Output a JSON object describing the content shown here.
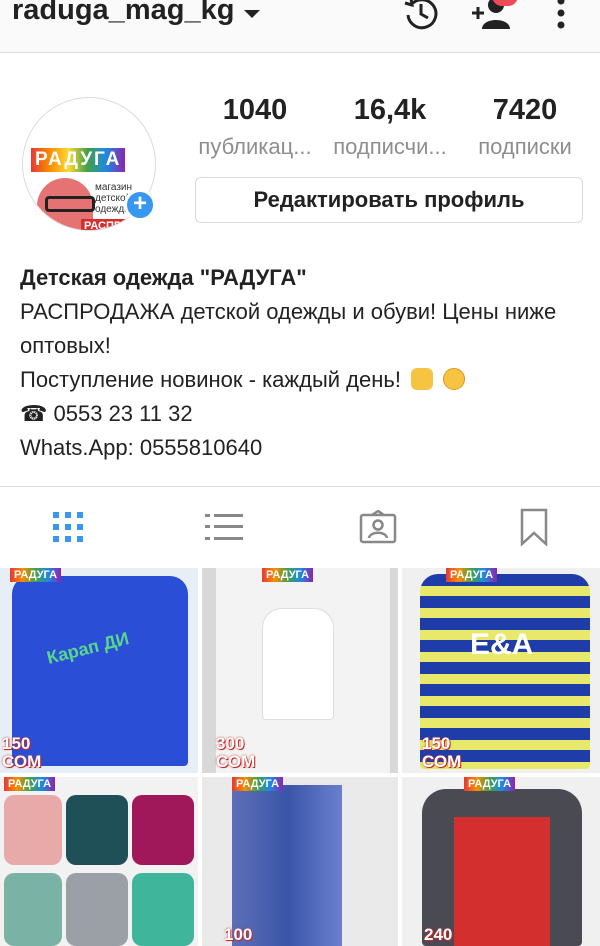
{
  "header": {
    "username": "raduga_mag_kg",
    "icons": [
      "chevron-down-icon",
      "history-icon",
      "add-user-icon",
      "more-icon"
    ]
  },
  "profile": {
    "avatar_brand": "РАДУГА",
    "avatar_subtitle": "магазин детской одежды",
    "avatar_sale": "РАСПРОДАЖА",
    "stats": [
      {
        "value": "1040",
        "label": "публикац..."
      },
      {
        "value": "16,4k",
        "label": "подписчи..."
      },
      {
        "value": "7420",
        "label": "подписки"
      }
    ],
    "edit_button": "Редактировать профиль"
  },
  "bio": {
    "name": "Детская одежда \"РАДУГА\"",
    "line1": "РАСПРОДАЖА детской одежды и обуви! Цены ниже оптовых!",
    "line2": "Поступление новинок - каждый день!",
    "phone": "☎ 0553 23 11 32",
    "whatsapp": "Whats.App: 0555810640"
  },
  "tabs": [
    "grid-icon",
    "list-icon",
    "tagged-icon",
    "saved-icon"
  ],
  "posts": [
    {
      "price": "150 СОМ",
      "tag": "РАДУГА",
      "color": "#2a4fd6"
    },
    {
      "price": "300 СОМ",
      "tag": "РАДУГА",
      "color": "#f0f0f0"
    },
    {
      "price": "150 СОМ",
      "tag": "РАДУГА",
      "color": "#1f3da8"
    },
    {
      "price": "",
      "tag": "РАДУГА",
      "color": "#d9a0a0"
    },
    {
      "price": "100",
      "tag": "РАДУГА",
      "color": "#3a55a8"
    },
    {
      "price": "240",
      "tag": "РАДУГА",
      "color": "#4a4a52"
    }
  ],
  "colors": {
    "accent": "#3897f0",
    "badge": "#ed4956",
    "muted": "#8e8e8e"
  }
}
